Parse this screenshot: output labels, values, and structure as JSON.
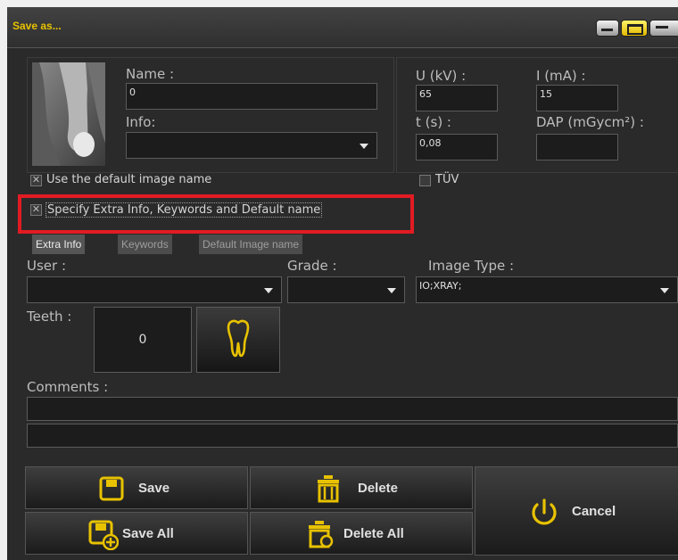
{
  "window": {
    "title": "Save as..."
  },
  "image_info": {
    "name_label": "Name :",
    "name_value": "0",
    "info_label": "Info:",
    "info_value": ""
  },
  "exposure": {
    "u_label": "U (kV) :",
    "u_value": "65",
    "i_label": "I (mA) :",
    "i_value": "15",
    "t_label": "t (s) :",
    "t_value": "0,08",
    "dap_label": "DAP (mGycm²) :",
    "dap_value": ""
  },
  "options": {
    "use_default_label": "Use the default image name",
    "use_default_checked": true,
    "tuv_label": "TÜV",
    "tuv_checked": false,
    "specify_extra_label": "Specify Extra Info, Keywords and Default name",
    "specify_extra_checked": true
  },
  "tabs": [
    {
      "label": "Extra Info",
      "active": true
    },
    {
      "label": "Keywords",
      "active": false
    },
    {
      "label": "Default Image name",
      "active": false
    }
  ],
  "extra": {
    "user_label": "User :",
    "user_value": "",
    "grade_label": "Grade :",
    "grade_value": "",
    "image_type_label": "Image Type :",
    "image_type_value": "IO;XRAY;",
    "teeth_label": "Teeth :",
    "teeth_value": "0",
    "comments_label": "Comments :",
    "comment_line1": "",
    "comment_line2": ""
  },
  "buttons": {
    "save": "Save",
    "delete": "Delete",
    "cancel": "Cancel",
    "save_all": "Save All",
    "delete_all": "Delete All"
  },
  "icons": {
    "save": "floppy-icon",
    "save_all": "floppy-plus-icon",
    "delete": "trash-icon",
    "delete_all": "trash-all-icon",
    "cancel": "power-icon",
    "teeth": "tooth-icon"
  },
  "colors": {
    "accent": "#e8c200",
    "highlight": "#e21b23",
    "background": "#2a2a2a"
  }
}
